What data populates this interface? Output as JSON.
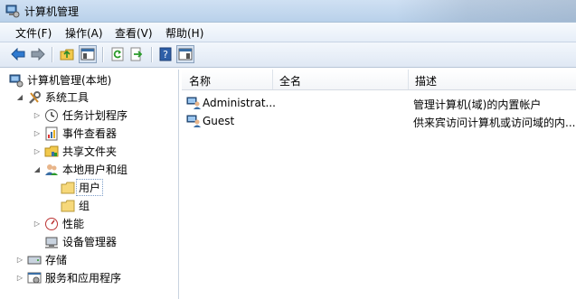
{
  "window": {
    "title": "计算机管理"
  },
  "menu": [
    "文件(F)",
    "操作(A)",
    "查看(V)",
    "帮助(H)"
  ],
  "toolbar": {
    "buttons": [
      "back-icon",
      "forward-icon",
      "up-folder-icon",
      "show-tree-icon",
      "refresh-icon",
      "export-icon",
      "help-icon",
      "show-action-pane-icon"
    ]
  },
  "tree": {
    "root": "计算机管理(本地)",
    "system_tools": "系统工具",
    "task_scheduler": "任务计划程序",
    "event_viewer": "事件查看器",
    "shared_folders": "共享文件夹",
    "local_users_groups": "本地用户和组",
    "users": "用户",
    "groups": "组",
    "performance": "性能",
    "device_manager": "设备管理器",
    "storage": "存储",
    "services_apps": "服务和应用程序"
  },
  "list": {
    "columns": [
      "名称",
      "全名",
      "描述"
    ],
    "rows": [
      {
        "name": "Administrat...",
        "full_name": "",
        "description": "管理计算机(域)的内置帐户"
      },
      {
        "name": "Guest",
        "full_name": "",
        "description": "供来宾访问计算机或访问域的内..."
      }
    ]
  },
  "colors": {
    "title_bg": "#c4d8ee",
    "menu_bg": "#eef3f9",
    "toolbar_bg": "#e8eef6",
    "selection_border": "#7a9cc8"
  }
}
